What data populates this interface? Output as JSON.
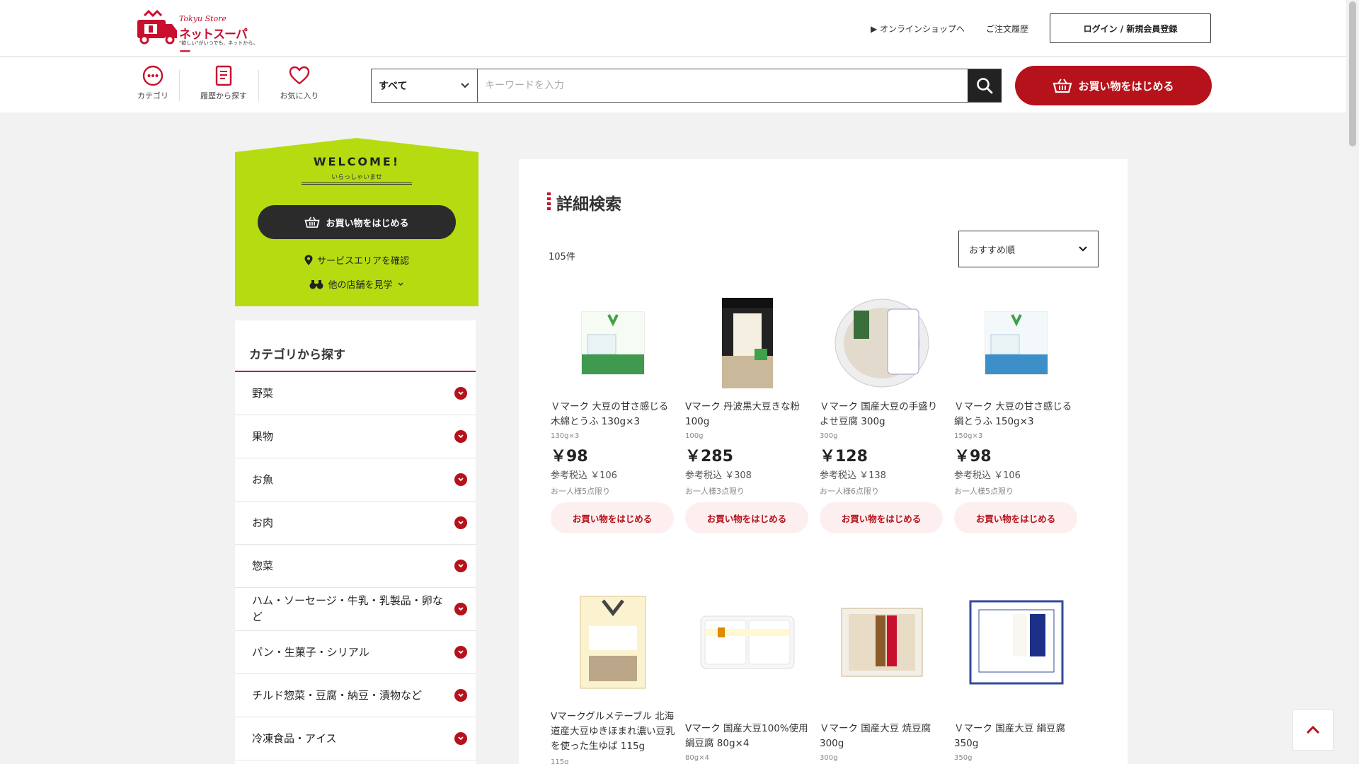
{
  "header": {
    "logo": {
      "brand_small": "Tokyu Store",
      "brand_big": "ネットスーパー",
      "tagline": "\"欲しい\"がいつでも、ネットから。"
    },
    "online_shop_link": "▶ オンラインショップへ",
    "order_history_link": "ご注文履歴",
    "login_button": "ログイン / 新規会員登録"
  },
  "nav": {
    "items": [
      {
        "label": "カテゴリ",
        "icon": "dots-circle-icon"
      },
      {
        "label": "履歴から探す",
        "icon": "history-list-icon"
      },
      {
        "label": "お気に入り",
        "icon": "heart-icon"
      }
    ]
  },
  "search": {
    "category_value": "すべて",
    "placeholder": "キーワードを入力",
    "value": ""
  },
  "start_shopping_label": "お買い物をはじめる",
  "welcome": {
    "title": "WELCOME!",
    "subtitle": "いらっしゃいませ",
    "button": "お買い物をはじめる",
    "service_area_link": "サービスエリアを確認",
    "other_stores_link": "他の店舗を見学"
  },
  "category_panel": {
    "title": "カテゴリから探す",
    "items": [
      "野菜",
      "果物",
      "お魚",
      "お肉",
      "惣菜",
      "ハム・ソーセージ・牛乳・乳製品・卵など",
      "パン・生菓子・シリアル",
      "チルド惣菜・豆腐・納豆・漬物など",
      "冷凍食品・アイス"
    ]
  },
  "results": {
    "title": "詳細検索",
    "count": "105件",
    "sort_value": "おすすめ順",
    "buy_label": "お買い物をはじめる",
    "products": [
      {
        "name": "Ｖマーク 大豆の甘さ感じる木綿とうふ 130g×3",
        "size": "130g×3",
        "price": "￥98",
        "tax": "参考税込 ￥106",
        "limit": "お一人様5点限り"
      },
      {
        "name": "Vマーク 丹波黒大豆きな粉 100g",
        "size": "100g",
        "price": "￥285",
        "tax": "参考税込 ￥308",
        "limit": "お一人様3点限り"
      },
      {
        "name": "Ｖマーク 国産大豆の手盛りよせ豆腐 300g",
        "size": "300g",
        "price": "￥128",
        "tax": "参考税込 ￥138",
        "limit": "お一人様6点限り"
      },
      {
        "name": "Ｖマーク 大豆の甘さ感じる絹とうふ 150g×3",
        "size": "150g×3",
        "price": "￥98",
        "tax": "参考税込 ￥106",
        "limit": "お一人様5点限り"
      },
      {
        "name": "Vマークグルメテーブル 北海道産大豆ゆきほまれ濃い豆乳を使った生ゆば 115g",
        "size": "115g"
      },
      {
        "name": "Vマーク 国産大豆100%使用 絹豆腐 80g×4",
        "size": "80g×4"
      },
      {
        "name": "Ｖマーク 国産大豆 焼豆腐 300g",
        "size": "300g"
      },
      {
        "name": "Ｖマーク 国産大豆 絹豆腐 350g",
        "size": "350g"
      }
    ]
  },
  "colors": {
    "accent_red": "#b5121b",
    "welcome_green": "#b5dc10",
    "buy_bg": "#fdeff0"
  }
}
